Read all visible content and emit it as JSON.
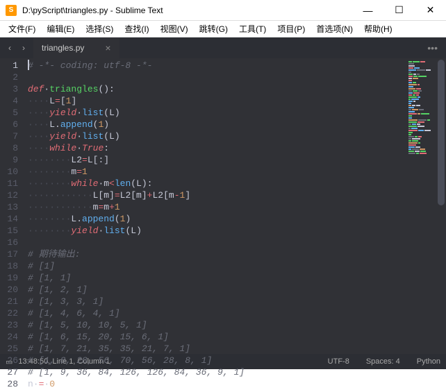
{
  "titlebar": {
    "icon_letter": "S",
    "title": "D:\\pyScript\\triangles.py - Sublime Text"
  },
  "menubar": {
    "items": [
      "文件(F)",
      "编辑(E)",
      "选择(S)",
      "查找(I)",
      "视图(V)",
      "跳转(G)",
      "工具(T)",
      "项目(P)",
      "首选项(N)",
      "帮助(H)"
    ]
  },
  "tabs": {
    "items": [
      {
        "label": "triangles.py",
        "active": true
      }
    ]
  },
  "code": {
    "lines": [
      {
        "n": 1,
        "active": true,
        "segs": [
          {
            "cls": "cmt",
            "t": "# -*- coding: utf-8 -*-"
          }
        ]
      },
      {
        "n": 2,
        "segs": []
      },
      {
        "n": 3,
        "segs": [
          {
            "cls": "kw",
            "t": "def"
          },
          {
            "cls": "",
            "t": "·"
          },
          {
            "cls": "fn",
            "t": "triangles"
          },
          {
            "cls": "",
            "t": "():"
          }
        ]
      },
      {
        "n": 4,
        "segs": [
          {
            "cls": "indent",
            "t": "····"
          },
          {
            "cls": "",
            "t": "L"
          },
          {
            "cls": "op",
            "t": "="
          },
          {
            "cls": "",
            "t": "["
          },
          {
            "cls": "num",
            "t": "1"
          },
          {
            "cls": "",
            "t": "]"
          }
        ]
      },
      {
        "n": 5,
        "segs": [
          {
            "cls": "indent",
            "t": "····"
          },
          {
            "cls": "kw",
            "t": "yield"
          },
          {
            "cls": "",
            "t": "·"
          },
          {
            "cls": "call",
            "t": "list"
          },
          {
            "cls": "",
            "t": "(L)"
          }
        ]
      },
      {
        "n": 6,
        "segs": [
          {
            "cls": "indent",
            "t": "····"
          },
          {
            "cls": "",
            "t": "L."
          },
          {
            "cls": "call",
            "t": "append"
          },
          {
            "cls": "",
            "t": "("
          },
          {
            "cls": "num",
            "t": "1"
          },
          {
            "cls": "",
            "t": ")"
          }
        ]
      },
      {
        "n": 7,
        "segs": [
          {
            "cls": "indent",
            "t": "····"
          },
          {
            "cls": "kw",
            "t": "yield"
          },
          {
            "cls": "",
            "t": "·"
          },
          {
            "cls": "call",
            "t": "list"
          },
          {
            "cls": "",
            "t": "(L)"
          }
        ]
      },
      {
        "n": 8,
        "segs": [
          {
            "cls": "indent",
            "t": "····"
          },
          {
            "cls": "kw",
            "t": "while"
          },
          {
            "cls": "",
            "t": "·"
          },
          {
            "cls": "const",
            "t": "True"
          },
          {
            "cls": "",
            "t": ":"
          }
        ]
      },
      {
        "n": 9,
        "segs": [
          {
            "cls": "indent",
            "t": "········"
          },
          {
            "cls": "",
            "t": "L2"
          },
          {
            "cls": "op",
            "t": "="
          },
          {
            "cls": "",
            "t": "L[:]"
          }
        ]
      },
      {
        "n": 10,
        "segs": [
          {
            "cls": "indent",
            "t": "········"
          },
          {
            "cls": "",
            "t": "m"
          },
          {
            "cls": "op",
            "t": "="
          },
          {
            "cls": "num",
            "t": "1"
          }
        ]
      },
      {
        "n": 11,
        "segs": [
          {
            "cls": "indent",
            "t": "········"
          },
          {
            "cls": "kw",
            "t": "while"
          },
          {
            "cls": "",
            "t": "·m"
          },
          {
            "cls": "op",
            "t": "<"
          },
          {
            "cls": "call",
            "t": "len"
          },
          {
            "cls": "",
            "t": "(L):"
          }
        ]
      },
      {
        "n": 12,
        "segs": [
          {
            "cls": "indent",
            "t": "············"
          },
          {
            "cls": "",
            "t": "L[m]"
          },
          {
            "cls": "op",
            "t": "="
          },
          {
            "cls": "",
            "t": "L2[m]"
          },
          {
            "cls": "op",
            "t": "+"
          },
          {
            "cls": "",
            "t": "L2[m"
          },
          {
            "cls": "op",
            "t": "-"
          },
          {
            "cls": "num",
            "t": "1"
          },
          {
            "cls": "",
            "t": "]"
          }
        ]
      },
      {
        "n": 13,
        "segs": [
          {
            "cls": "indent",
            "t": "············"
          },
          {
            "cls": "",
            "t": "m"
          },
          {
            "cls": "op",
            "t": "="
          },
          {
            "cls": "",
            "t": "m"
          },
          {
            "cls": "op",
            "t": "+"
          },
          {
            "cls": "num",
            "t": "1"
          }
        ]
      },
      {
        "n": 14,
        "segs": [
          {
            "cls": "indent",
            "t": "········"
          },
          {
            "cls": "",
            "t": "L."
          },
          {
            "cls": "call",
            "t": "append"
          },
          {
            "cls": "",
            "t": "("
          },
          {
            "cls": "num",
            "t": "1"
          },
          {
            "cls": "",
            "t": ")"
          }
        ]
      },
      {
        "n": 15,
        "segs": [
          {
            "cls": "indent",
            "t": "········"
          },
          {
            "cls": "kw",
            "t": "yield"
          },
          {
            "cls": "",
            "t": "·"
          },
          {
            "cls": "call",
            "t": "list"
          },
          {
            "cls": "",
            "t": "(L)"
          }
        ]
      },
      {
        "n": 16,
        "segs": []
      },
      {
        "n": 17,
        "segs": [
          {
            "cls": "cmt",
            "t": "# 期待输出:"
          }
        ]
      },
      {
        "n": 18,
        "segs": [
          {
            "cls": "cmt",
            "t": "# [1]"
          }
        ]
      },
      {
        "n": 19,
        "segs": [
          {
            "cls": "cmt",
            "t": "# [1, 1]"
          }
        ]
      },
      {
        "n": 20,
        "segs": [
          {
            "cls": "cmt",
            "t": "# [1, 2, 1]"
          }
        ]
      },
      {
        "n": 21,
        "segs": [
          {
            "cls": "cmt",
            "t": "# [1, 3, 3, 1]"
          }
        ]
      },
      {
        "n": 22,
        "segs": [
          {
            "cls": "cmt",
            "t": "# [1, 4, 6, 4, 1]"
          }
        ]
      },
      {
        "n": 23,
        "segs": [
          {
            "cls": "cmt",
            "t": "# [1, 5, 10, 10, 5, 1]"
          }
        ]
      },
      {
        "n": 24,
        "segs": [
          {
            "cls": "cmt",
            "t": "# [1, 6, 15, 20, 15, 6, 1]"
          }
        ]
      },
      {
        "n": 25,
        "segs": [
          {
            "cls": "cmt",
            "t": "# [1, 7, 21, 35, 35, 21, 7, 1]"
          }
        ]
      },
      {
        "n": 26,
        "segs": [
          {
            "cls": "cmt",
            "t": "# [1, 8, 28, 56, 70, 56, 28, 8, 1]"
          }
        ]
      },
      {
        "n": 27,
        "segs": [
          {
            "cls": "cmt",
            "t": "# [1, 9, 36, 84, 126, 126, 84, 36, 9, 1]"
          }
        ]
      },
      {
        "n": 28,
        "segs": [
          {
            "cls": "",
            "t": "n·"
          },
          {
            "cls": "op",
            "t": "="
          },
          {
            "cls": "",
            "t": "·"
          },
          {
            "cls": "num",
            "t": "0"
          }
        ]
      }
    ]
  },
  "statusbar": {
    "panel_icon": "▭",
    "position": "13:48:50, Line 1, Column 1",
    "encoding": "UTF-8",
    "tabs": "Spaces: 4",
    "syntax": "Python"
  }
}
